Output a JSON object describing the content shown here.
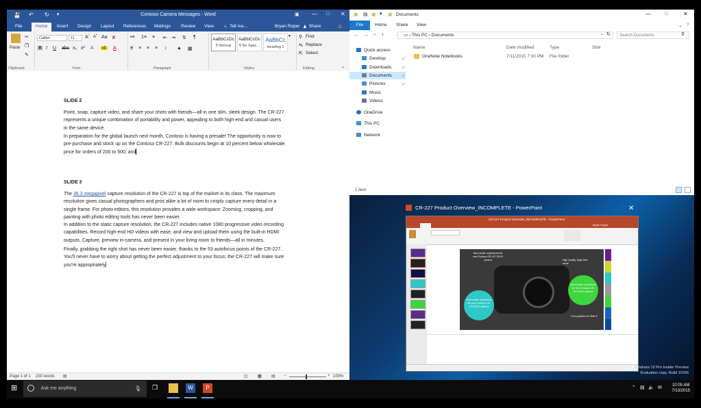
{
  "word": {
    "quick_access": [
      "save-icon",
      "undo-icon",
      "redo-icon"
    ],
    "title": "Contoso Camera Messages - Word",
    "tabs": [
      "File",
      "Home",
      "Insert",
      "Design",
      "Layout",
      "References",
      "Mailings",
      "Review",
      "View"
    ],
    "tell_me": "Tell me...",
    "user": "Bryan Roper",
    "share": "Share",
    "font_name": "Calibri",
    "font_size": "11",
    "paste_label": "Paste",
    "groups": [
      "Clipboard",
      "Font",
      "Paragraph",
      "Styles",
      "Editing"
    ],
    "styles": [
      {
        "preview": "AaBbCcDc",
        "name": "¶ Normal"
      },
      {
        "preview": "AaBbCcDc",
        "name": "¶ No Spac..."
      },
      {
        "preview": "AaBbCc",
        "name": "Heading 1"
      }
    ],
    "editing": [
      "Find",
      "Replace",
      "Select"
    ],
    "slide2_heading": "SLIDE 2",
    "slide2_p1": "Point, snap, capture video, and share your shots with friends—all in one slim, sleek design. The CR-227 represents a unique combination of portability and power, appealing to both high-end and casual users in the same device.",
    "slide2_p2": "In preparation for the global launch next month, Contoso is having a presale! The opportunity is now to pre-purchase and stock up on the Contoso CR-227. Bulk discounts begin at 10 percent below wholesale price for orders of 200 to 500, and",
    "slide3_heading": "SLIDE 3",
    "slide3_p1_pre": "The ",
    "slide3_p1_link": "36.3 megapixel",
    "slide3_p1_post": " capture resolution of the CR-227 is top of the market in its class. The maximum resolution gives casual photographers and pros alike a lot of room to crisply capture every detail in a single frame. For photo editors, this resolution provides a wide workspace: Zooming, cropping, and painting with photo editing tools has never been easier.",
    "slide3_p2": "In addition to the static capture resolution, the CR-227 includes native 1080 progressive video recording capabilities. Record high-end HD videos with ease, and view and upload them using the built-in HDMI outputs. Capture, preview in-camera, and present in your living room to friends—all in minutes.",
    "slide3_p3": "Finally, grabbing the right shot has never been easier, thanks to the 53 autofocus points of the CR-227. You'll never have to worry about getting the perfect adjustment to your focus; the CR-227 will make sure you're appropriately",
    "status_page": "Page 1 of 1",
    "status_words": "230 words",
    "zoom": "100%"
  },
  "explorer": {
    "title": "Documents",
    "tabs": [
      "File",
      "Home",
      "Share",
      "View"
    ],
    "path": [
      "This PC",
      "Documents"
    ],
    "search_placeholder": "Search Documents",
    "nav": [
      {
        "label": "Quick access",
        "icon": "star-icon",
        "color": "#1979ca"
      },
      {
        "label": "Desktop",
        "icon": "desktop-icon",
        "color": "#3a8fd6"
      },
      {
        "label": "Downloads",
        "icon": "download-icon",
        "color": "#2b78c2"
      },
      {
        "label": "Documents",
        "icon": "document-icon",
        "color": "#6b7c93"
      },
      {
        "label": "Pictures",
        "icon": "pictures-icon",
        "color": "#4a8fd4"
      },
      {
        "label": "Music",
        "icon": "music-icon",
        "color": "#2b78c2"
      },
      {
        "label": "Videos",
        "icon": "video-icon",
        "color": "#6b6b9c"
      },
      {
        "label": "OneDrive",
        "icon": "cloud-icon",
        "color": "#1f6fc5"
      },
      {
        "label": "This PC",
        "icon": "computer-icon",
        "color": "#3a8fd6"
      },
      {
        "label": "Network",
        "icon": "network-icon",
        "color": "#3a8fd6"
      }
    ],
    "columns": [
      "Name",
      "Date modified",
      "Type",
      "Size"
    ],
    "files": [
      {
        "name": "OneNote Notebooks",
        "date": "7/11/2015 7:30 PM",
        "type": "File folder",
        "size": ""
      }
    ],
    "status": "1 item"
  },
  "powerpoint": {
    "title": "CR-227 Product Overview_INCOMPLETE - PowerPoint",
    "inner_title": "CR-227 Product Overview_INCOMPLETE - PowerPoint",
    "user": "Bryan Roper",
    "bubble1": "Next month, experience the next Contoso CR-227 DSLR camera",
    "bubble2": "Next month, experience the new Contoso CR-227 DSLR camera",
    "bubble3": "Next month, experience the new Contoso CR-227 DSLR camera",
    "caption1": "High Quality, Night time mode",
    "caption2": "Core graphics for Slide 6",
    "colors": [
      "#6a1b9a",
      "#c6d82b",
      "#2ec8c8",
      "#999999",
      "#3ed63e",
      "#1565c0",
      "#0d47a1"
    ]
  },
  "watermark": [
    "Windows 10 Pro Insider Preview",
    "Evaluation copy. Build 10166"
  ],
  "taskbar": {
    "search_placeholder": "Ask me anything",
    "time": "10:05 AM",
    "date": "7/13/2015"
  }
}
